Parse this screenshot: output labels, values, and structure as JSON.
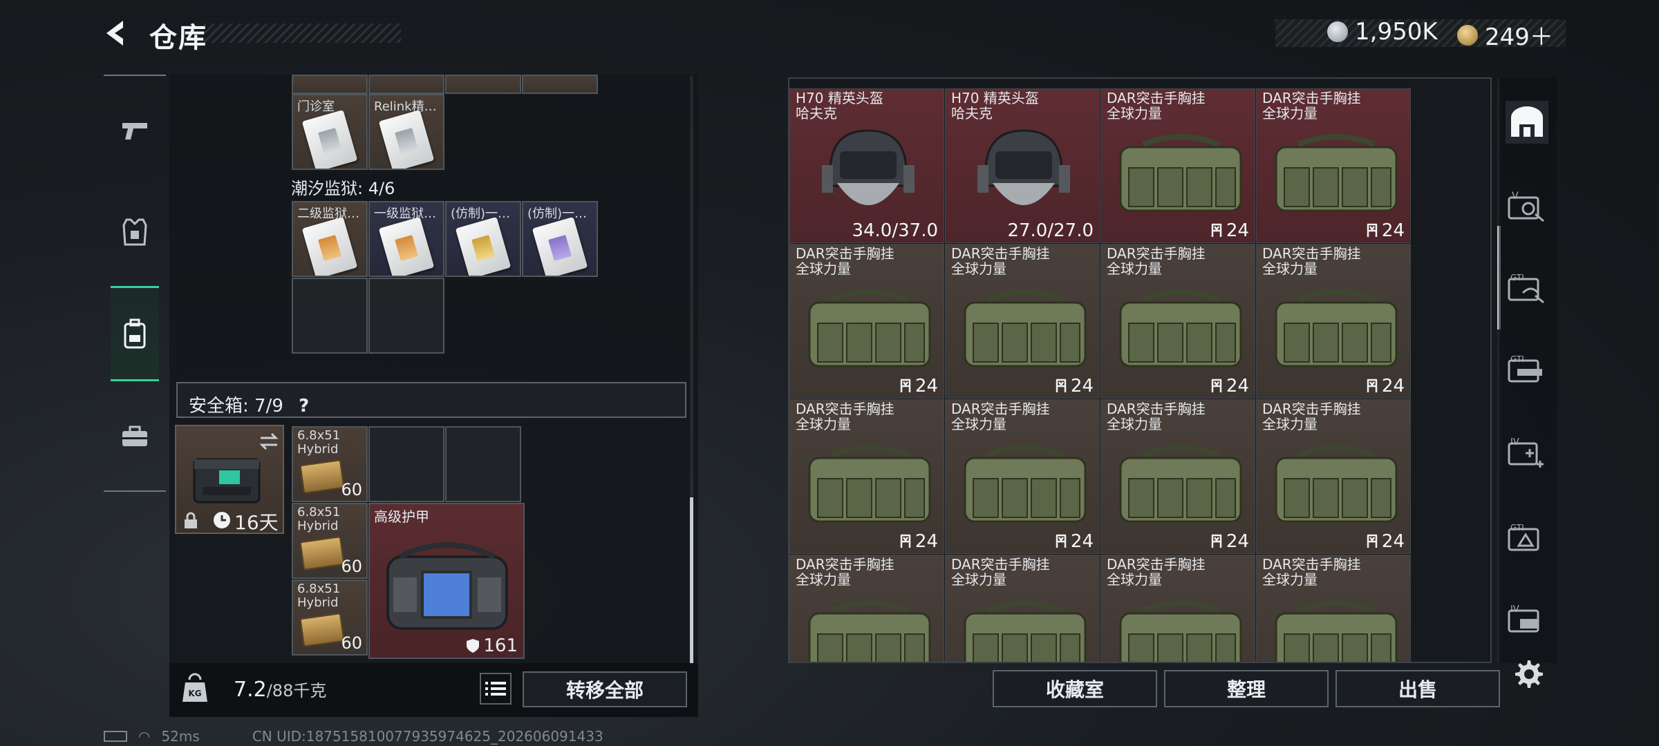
{
  "header": {
    "title": "仓库",
    "currency": [
      {
        "icon": "silver-coin-icon",
        "value": "1,950K",
        "color": "#b8bec4"
      },
      {
        "icon": "gold-triangle-coin-icon",
        "value": "249＋",
        "color": "#c9a45a"
      }
    ]
  },
  "left_rail": {
    "tabs": [
      {
        "icon": "pistol-icon",
        "active": false
      },
      {
        "icon": "armor-vest-icon",
        "active": false
      },
      {
        "icon": "backpack-icon",
        "active": true
      },
      {
        "icon": "briefcase-icon",
        "active": false
      }
    ]
  },
  "left_panel": {
    "top_cells": [
      {
        "label": "门诊室",
        "card": "silver"
      },
      {
        "label": "Relink精…",
        "card": "silver"
      }
    ],
    "section_title": "潮汐监狱: 4/6",
    "prison_cells": [
      {
        "label": "二级监狱…",
        "card": "orange"
      },
      {
        "label": "一级监狱…",
        "card": "orange"
      },
      {
        "label": "(仿制)一…",
        "card": "gold"
      },
      {
        "label": "(仿制)一…",
        "card": "purple"
      }
    ],
    "safe_box": {
      "title": "安全箱: 7/9",
      "help": "?",
      "duration": "16天",
      "swap_icon": "swap-arrows-icon",
      "lock_icon": "lock-icon"
    },
    "ammo": [
      {
        "label": "6.8x51 Hybrid",
        "count": "60"
      },
      {
        "label": "6.8x51 Hybrid",
        "count": "60"
      },
      {
        "label": "6.8x51 Hybrid",
        "count": "60"
      }
    ],
    "armor": {
      "label": "高级护甲",
      "value": "161"
    },
    "weight": {
      "current": "7.2",
      "max": "/88千克"
    },
    "transfer_all": "转移全部"
  },
  "right_panel": {
    "items": [
      {
        "name1": "H70 精英头盔",
        "name2": "哈夫克",
        "value": "34.0/37.0",
        "type": "helmet",
        "color": "red"
      },
      {
        "name1": "H70 精英头盔",
        "name2": "哈夫克",
        "value": "27.0/27.0",
        "type": "helmet",
        "color": "red"
      },
      {
        "name1": "DAR突击手胸挂",
        "name2": "全球力量",
        "value": "24",
        "type": "bag",
        "color": "red"
      },
      {
        "name1": "DAR突击手胸挂",
        "name2": "全球力量",
        "value": "24",
        "type": "bag",
        "color": "red"
      },
      {
        "name1": "DAR突击手胸挂",
        "name2": "全球力量",
        "value": "24",
        "type": "bag",
        "color": "brown"
      },
      {
        "name1": "DAR突击手胸挂",
        "name2": "全球力量",
        "value": "24",
        "type": "bag",
        "color": "brown"
      },
      {
        "name1": "DAR突击手胸挂",
        "name2": "全球力量",
        "value": "24",
        "type": "bag",
        "color": "brown"
      },
      {
        "name1": "DAR突击手胸挂",
        "name2": "全球力量",
        "value": "24",
        "type": "bag",
        "color": "brown"
      },
      {
        "name1": "DAR突击手胸挂",
        "name2": "全球力量",
        "value": "24",
        "type": "bag",
        "color": "brown"
      },
      {
        "name1": "DAR突击手胸挂",
        "name2": "全球力量",
        "value": "24",
        "type": "bag",
        "color": "brown"
      },
      {
        "name1": "DAR突击手胸挂",
        "name2": "全球力量",
        "value": "24",
        "type": "bag",
        "color": "brown"
      },
      {
        "name1": "DAR突击手胸挂",
        "name2": "全球力量",
        "value": "24",
        "type": "bag",
        "color": "brown"
      },
      {
        "name1": "DAR突击手胸挂",
        "name2": "全球力量",
        "value": "",
        "type": "bag",
        "color": "brown"
      },
      {
        "name1": "DAR突击手胸挂",
        "name2": "全球力量",
        "value": "",
        "type": "bag",
        "color": "brown"
      },
      {
        "name1": "DAR突击手胸挂",
        "name2": "全球力量",
        "value": "",
        "type": "bag",
        "color": "brown"
      },
      {
        "name1": "DAR突击手胸挂",
        "name2": "全球力量",
        "value": "",
        "type": "bag",
        "color": "brown"
      }
    ],
    "buttons": {
      "collection": "收藏室",
      "organize": "整理",
      "sell": "出售"
    }
  },
  "right_rail": {
    "items": [
      "home-vault-icon",
      "keycard-v-icon",
      "keycard-gti-icon",
      "keycard-gti2-icon",
      "keycard-iv-plus-icon",
      "keycard-gti3-icon",
      "keycard-iv-icon"
    ]
  },
  "status_bar": {
    "ping": "52ms",
    "uid": "CN UID:18751581007793597462​5_202606091433"
  }
}
